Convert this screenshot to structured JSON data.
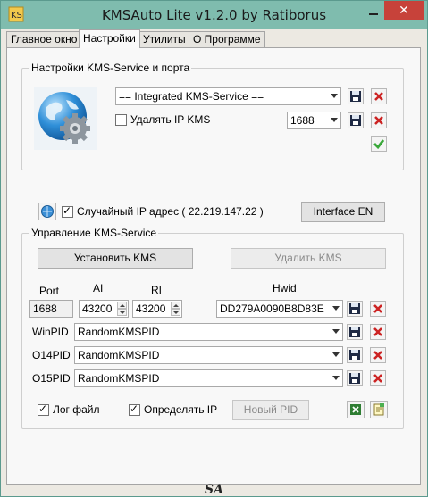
{
  "window": {
    "title": "KMSAuto Lite v1.2.0 by Ratiborus",
    "close_glyph": "✕"
  },
  "tabs": [
    {
      "label": "Главное окно"
    },
    {
      "label": "Настройки"
    },
    {
      "label": "Утилиты"
    },
    {
      "label": "О Программе"
    }
  ],
  "kms_service_group": {
    "legend": "Настройки KMS-Service и порта",
    "service_select": "== Integrated KMS-Service ==",
    "remove_ip_label": "Удалять IP KMS",
    "remove_ip_checked": false,
    "port_select": "1688"
  },
  "random_ip": {
    "checked": true,
    "label": "Случайный IP адрес ( 22.219.147.22 )",
    "interface_button": "Interface EN"
  },
  "manage_group": {
    "legend": "Управление KMS-Service",
    "install_button": "Установить KMS",
    "remove_button": "Удалить KMS",
    "headers": {
      "port": "Port",
      "ai": "AI",
      "ri": "RI",
      "hwid": "Hwid"
    },
    "port_value": "1688",
    "ai_value": "43200",
    "ri_value": "43200",
    "hwid_value": "DD279A0090B8D83E",
    "pid_rows": [
      {
        "label": "WinPID",
        "value": "RandomKMSPID"
      },
      {
        "label": "O14PID",
        "value": "RandomKMSPID"
      },
      {
        "label": "O15PID",
        "value": "RandomKMSPID"
      }
    ],
    "log_file_label": "Лог файл",
    "log_file_checked": true,
    "detect_ip_label": "Определять IP",
    "detect_ip_checked": true,
    "new_pid_button": "Новый PID"
  },
  "footer": {
    "signature": "SA"
  },
  "colors": {
    "titlebar": "#7fbcae",
    "close": "#c7423a",
    "panel": "#f8f8f8",
    "delete_red": "#cc2222",
    "ok_green": "#3aa83a"
  }
}
